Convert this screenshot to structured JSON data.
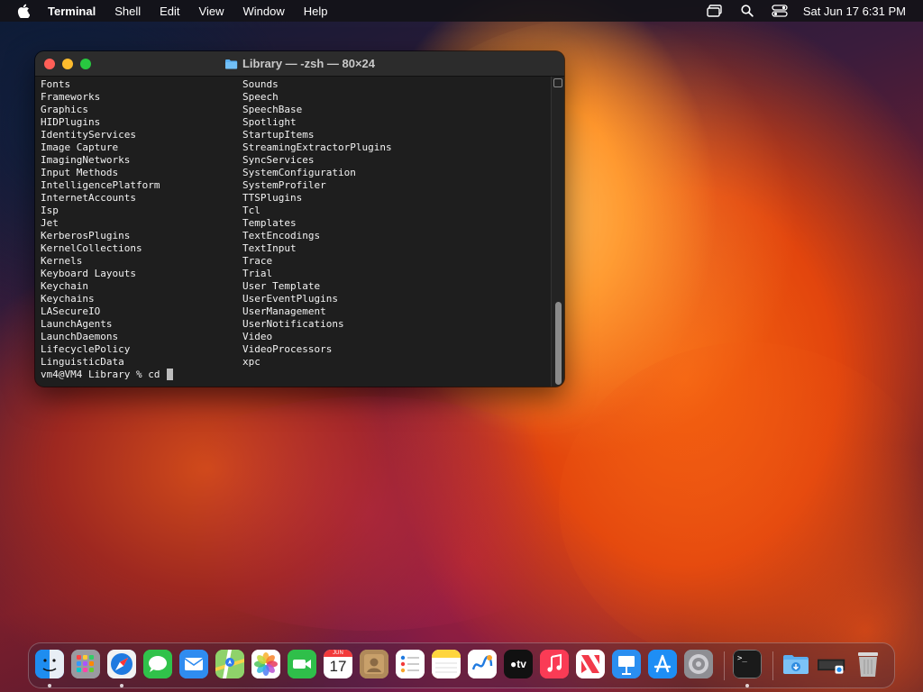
{
  "menubar": {
    "app_name": "Terminal",
    "items": [
      "Shell",
      "Edit",
      "View",
      "Window",
      "Help"
    ],
    "clock": "Sat Jun 17  6:31 PM"
  },
  "terminal": {
    "title": "Library — -zsh — 80×24",
    "rows": [
      [
        "Fonts",
        "Sounds"
      ],
      [
        "Frameworks",
        "Speech"
      ],
      [
        "Graphics",
        "SpeechBase"
      ],
      [
        "HIDPlugins",
        "Spotlight"
      ],
      [
        "IdentityServices",
        "StartupItems"
      ],
      [
        "Image Capture",
        "StreamingExtractorPlugins"
      ],
      [
        "ImagingNetworks",
        "SyncServices"
      ],
      [
        "Input Methods",
        "SystemConfiguration"
      ],
      [
        "IntelligencePlatform",
        "SystemProfiler"
      ],
      [
        "InternetAccounts",
        "TTSPlugins"
      ],
      [
        "Isp",
        "Tcl"
      ],
      [
        "Jet",
        "Templates"
      ],
      [
        "KerberosPlugins",
        "TextEncodings"
      ],
      [
        "KernelCollections",
        "TextInput"
      ],
      [
        "Kernels",
        "Trace"
      ],
      [
        "Keyboard Layouts",
        "Trial"
      ],
      [
        "Keychain",
        "User Template"
      ],
      [
        "Keychains",
        "UserEventPlugins"
      ],
      [
        "LASecureIO",
        "UserManagement"
      ],
      [
        "LaunchAgents",
        "UserNotifications"
      ],
      [
        "LaunchDaemons",
        "Video"
      ],
      [
        "LifecyclePolicy",
        "VideoProcessors"
      ],
      [
        "LinguisticData",
        "xpc"
      ]
    ],
    "prompt": "vm4@VM4 Library % cd "
  },
  "dock": {
    "calendar_month": "JUN",
    "calendar_day": "17",
    "tv_label": "tv",
    "terminal_glyph": ">_",
    "apps": [
      {
        "name": "finder-icon",
        "color": "#1e8df0"
      },
      {
        "name": "launchpad-icon",
        "color": "#8e8e93"
      },
      {
        "name": "safari-icon",
        "color": "#1f7ae0"
      },
      {
        "name": "messages-icon",
        "color": "#30c24a"
      },
      {
        "name": "mail-icon",
        "color": "#2f8cf0"
      },
      {
        "name": "maps-icon",
        "color": "#4fb34f"
      },
      {
        "name": "photos-icon",
        "color": "#ffffff"
      },
      {
        "name": "facetime-icon",
        "color": "#2fbf4a"
      },
      {
        "name": "calendar-icon",
        "color": "#ffffff"
      },
      {
        "name": "contacts-icon",
        "color": "#b08a5a"
      },
      {
        "name": "reminders-icon",
        "color": "#ffffff"
      },
      {
        "name": "notes-icon",
        "color": "#ffd53d"
      },
      {
        "name": "freeform-icon",
        "color": "#ffffff"
      },
      {
        "name": "apple-tv-icon",
        "color": "#111111"
      },
      {
        "name": "music-icon",
        "color": "#fa3b55"
      },
      {
        "name": "news-icon",
        "color": "#f23a4a"
      },
      {
        "name": "keynote-icon",
        "color": "#2a8ef0"
      },
      {
        "name": "app-store-icon",
        "color": "#1e8ef5"
      },
      {
        "name": "system-settings-icon",
        "color": "#8e8e93"
      },
      {
        "name": "terminal-icon",
        "color": "#1a1a1a"
      },
      {
        "name": "downloads-folder-icon",
        "color": "#5aaef0"
      },
      {
        "name": "screenshot-stack-icon",
        "color": "#2a2a2a"
      },
      {
        "name": "trash-icon",
        "color": "#b8b8b8"
      }
    ]
  }
}
